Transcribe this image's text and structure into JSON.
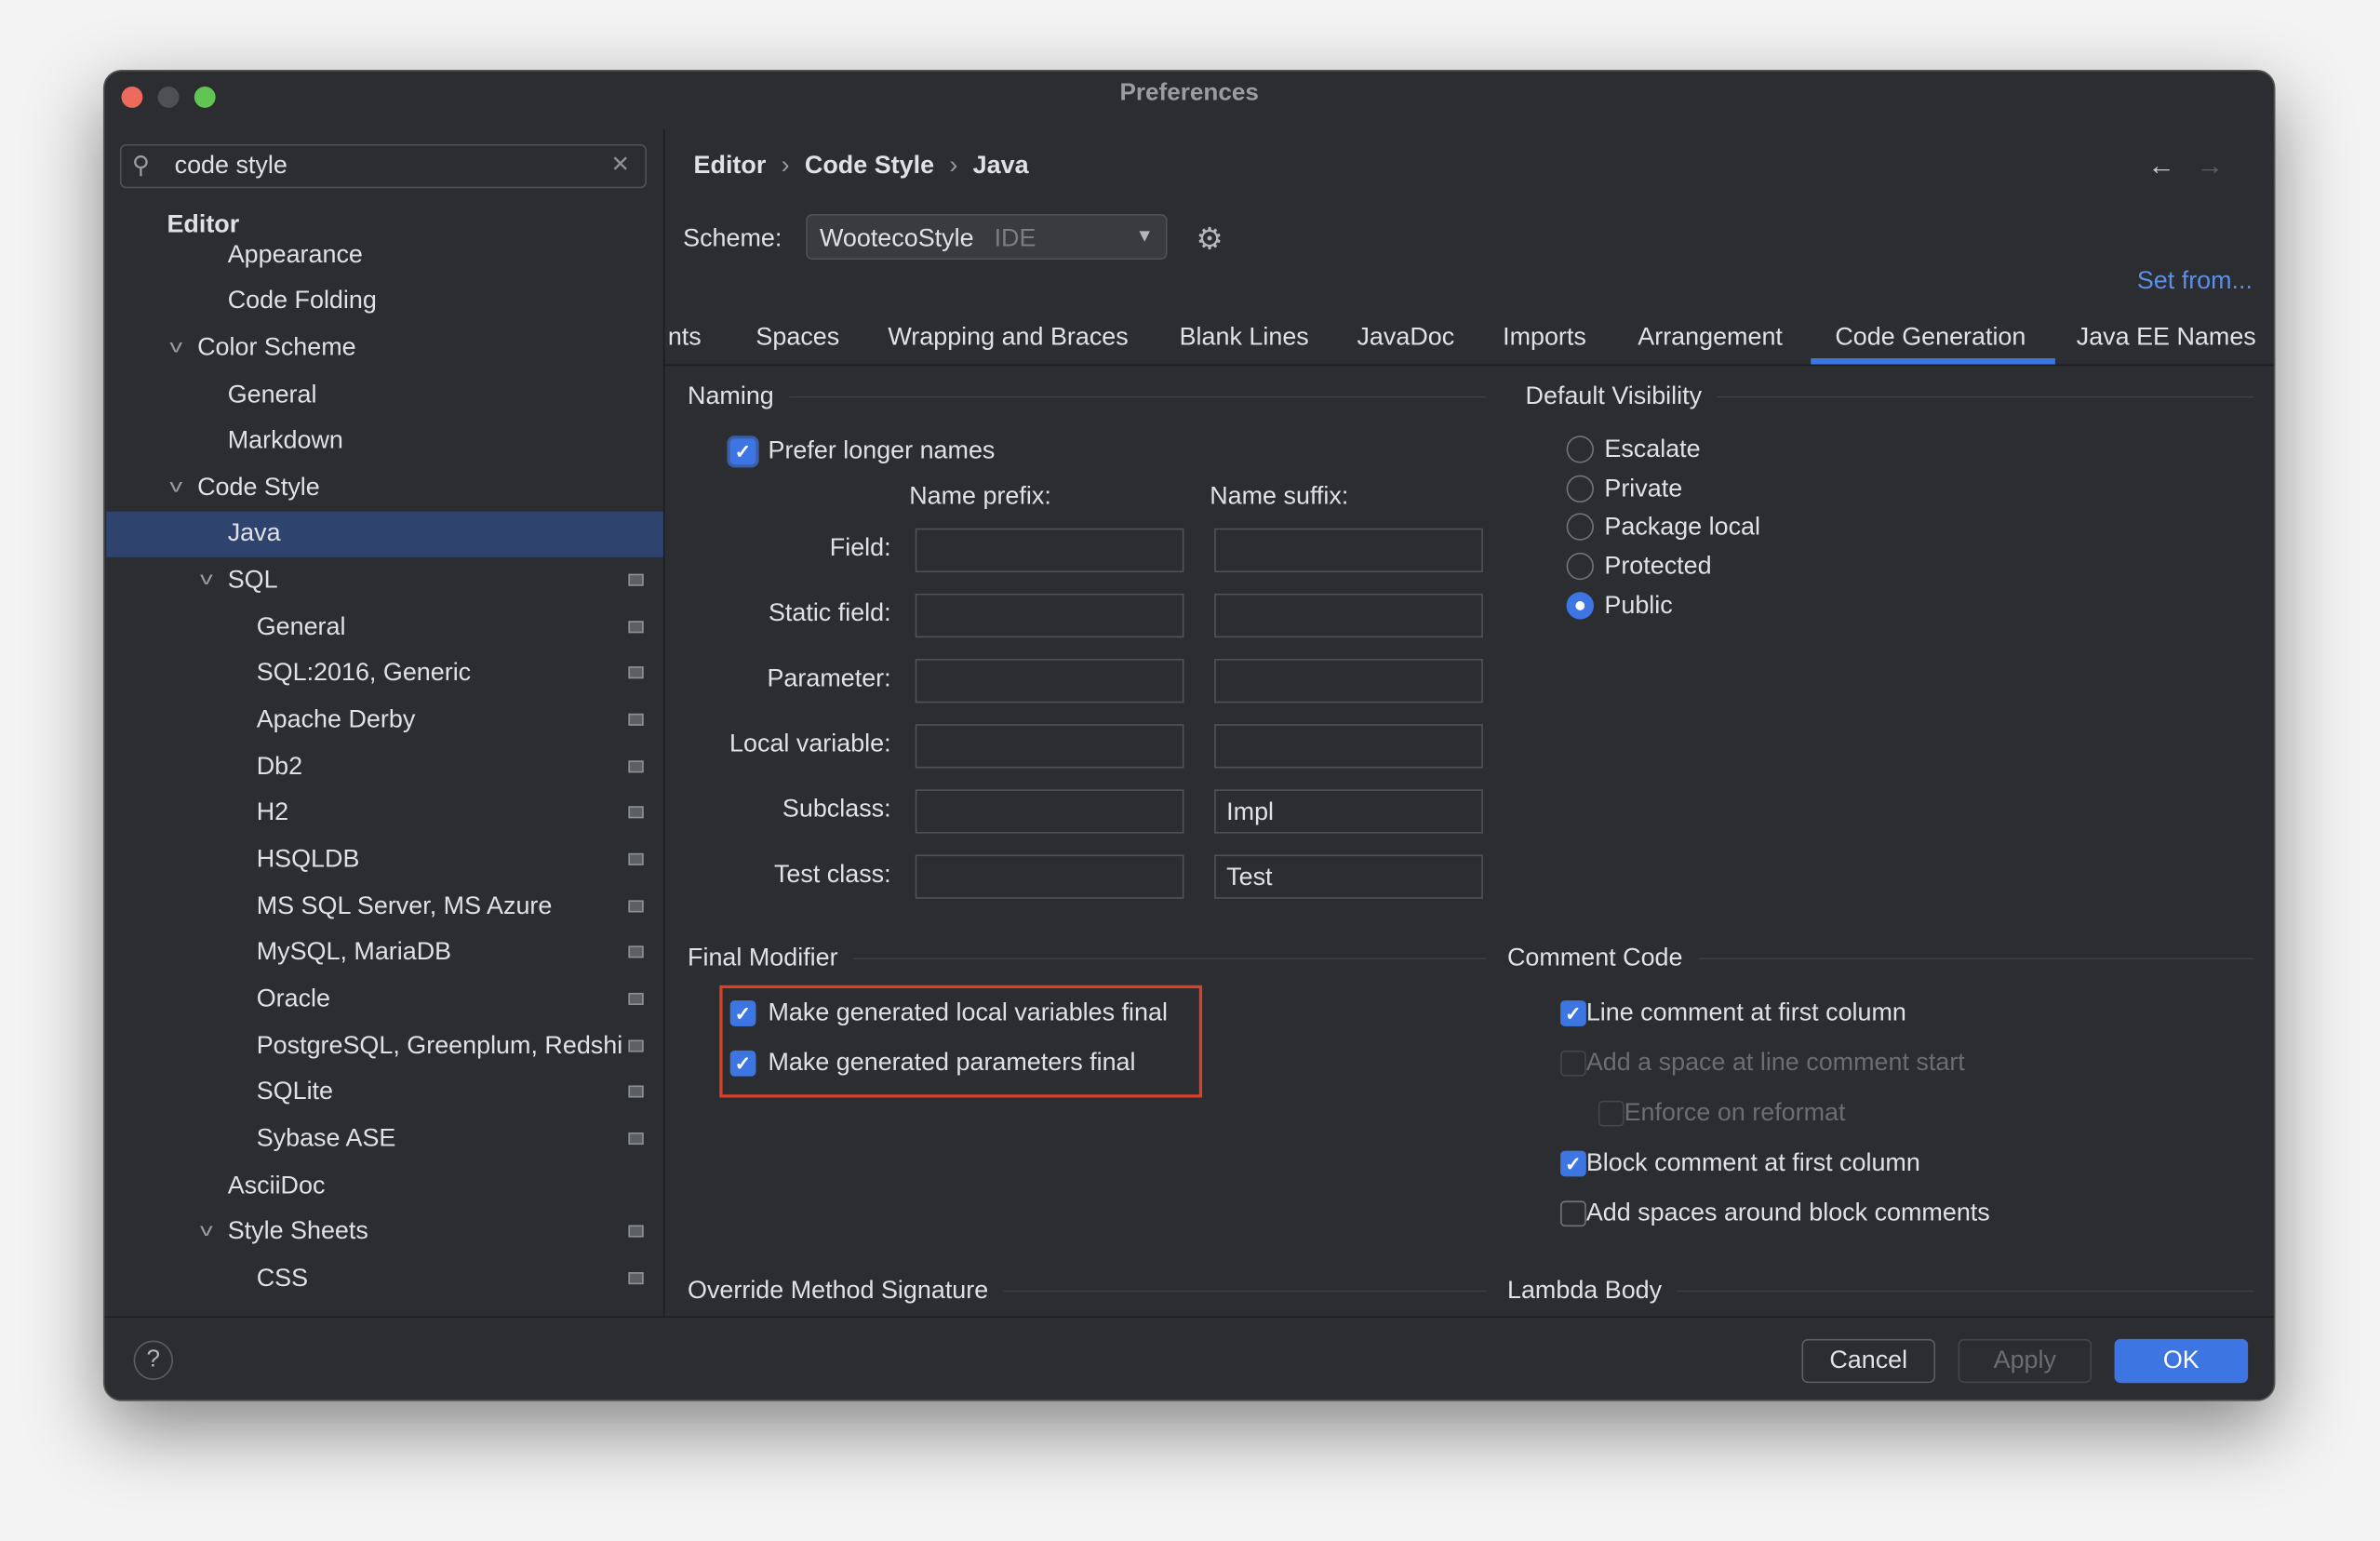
{
  "window": {
    "title": "Preferences"
  },
  "search": {
    "value": "code style"
  },
  "tree": [
    {
      "label": "Editor",
      "level": 0,
      "bold": true
    },
    {
      "label": "Appearance",
      "level": 1
    },
    {
      "label": "Code Folding",
      "level": 1
    },
    {
      "label": "Color Scheme",
      "level": "1a",
      "expanded": true
    },
    {
      "label": "General",
      "level": 1
    },
    {
      "label": "Markdown",
      "level": 1
    },
    {
      "label": "Code Style",
      "level": "1a",
      "expanded": true
    },
    {
      "label": "Java",
      "level": 1,
      "selected": true
    },
    {
      "label": "SQL",
      "level": "2a",
      "expanded": true,
      "icon": true
    },
    {
      "label": "General",
      "level": 2,
      "icon": true
    },
    {
      "label": "SQL:2016, Generic",
      "level": 2,
      "icon": true
    },
    {
      "label": "Apache Derby",
      "level": 2,
      "icon": true
    },
    {
      "label": "Db2",
      "level": 2,
      "icon": true
    },
    {
      "label": "H2",
      "level": 2,
      "icon": true
    },
    {
      "label": "HSQLDB",
      "level": 2,
      "icon": true
    },
    {
      "label": "MS SQL Server, MS Azure",
      "level": 2,
      "icon": true
    },
    {
      "label": "MySQL, MariaDB",
      "level": 2,
      "icon": true
    },
    {
      "label": "Oracle",
      "level": 2,
      "icon": true
    },
    {
      "label": "PostgreSQL, Greenplum, Redshi",
      "level": 2,
      "icon": true
    },
    {
      "label": "SQLite",
      "level": 2,
      "icon": true
    },
    {
      "label": "Sybase ASE",
      "level": 2,
      "icon": true
    },
    {
      "label": "AsciiDoc",
      "level": 1
    },
    {
      "label": "Style Sheets",
      "level": "2a",
      "expanded": true,
      "icon": true
    },
    {
      "label": "CSS",
      "level": 2,
      "icon": true
    }
  ],
  "breadcrumb": [
    "Editor",
    "Code Style",
    "Java"
  ],
  "scheme": {
    "label": "Scheme:",
    "value": "WootecoStyle",
    "tag": "IDE",
    "set_from": "Set from..."
  },
  "tabs": [
    "nts",
    "Spaces",
    "Wrapping and Braces",
    "Blank Lines",
    "JavaDoc",
    "Imports",
    "Arrangement",
    "Code Generation",
    "Java EE Names"
  ],
  "active_tab": "Code Generation",
  "naming": {
    "title": "Naming",
    "prefer_longer": {
      "label": "Prefer longer names",
      "checked": true
    },
    "prefix_header": "Name prefix:",
    "suffix_header": "Name suffix:",
    "rows": [
      {
        "label": "Field:",
        "prefix": "",
        "suffix": ""
      },
      {
        "label": "Static field:",
        "prefix": "",
        "suffix": ""
      },
      {
        "label": "Parameter:",
        "prefix": "",
        "suffix": ""
      },
      {
        "label": "Local variable:",
        "prefix": "",
        "suffix": ""
      },
      {
        "label": "Subclass:",
        "prefix": "",
        "suffix": "Impl"
      },
      {
        "label": "Test class:",
        "prefix": "",
        "suffix": "Test"
      }
    ]
  },
  "visibility": {
    "title": "Default Visibility",
    "options": [
      "Escalate",
      "Private",
      "Package local",
      "Protected",
      "Public"
    ],
    "selected": "Public"
  },
  "final_modifier": {
    "title": "Final Modifier",
    "items": [
      {
        "label": "Make generated local variables final",
        "checked": true
      },
      {
        "label": "Make generated parameters final",
        "checked": true
      }
    ]
  },
  "comment_code": {
    "title": "Comment Code",
    "items": [
      {
        "label": "Line comment at first column",
        "checked": true
      },
      {
        "label": "Add a space at line comment start",
        "checked": false,
        "disabled": true
      },
      {
        "label": "Enforce on reformat",
        "checked": false,
        "disabled": true,
        "indent": true
      },
      {
        "label": "Block comment at first column",
        "checked": true
      },
      {
        "label": "Add spaces around block comments",
        "checked": false
      }
    ]
  },
  "override": {
    "title": "Override Method Signature"
  },
  "lambda": {
    "title": "Lambda Body"
  },
  "footer": {
    "help": "?",
    "cancel": "Cancel",
    "apply": "Apply",
    "ok": "OK"
  },
  "colors": {
    "accent": "#3d75e2",
    "highlight_box": "#d9402a",
    "selection": "#2e436e"
  }
}
